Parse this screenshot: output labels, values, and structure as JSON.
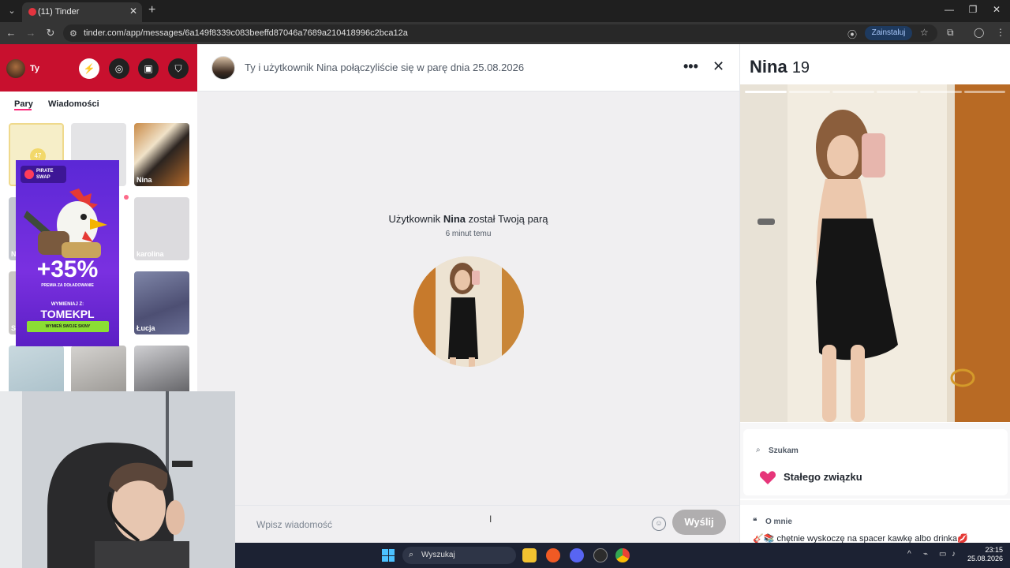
{
  "browser": {
    "tab_title": "(11) Tinder",
    "tab_close": "✕",
    "new_tab": "+",
    "url": "tinder.com/app/messages/6a149f8339c083beeffd87046a7689a210418996c2bca12a",
    "install_label": "Zainstaluj",
    "window_controls": [
      "—",
      "❐",
      "✕"
    ]
  },
  "sidebar": {
    "user_name": "Ty",
    "header_icons": [
      "boost-icon",
      "explore-icon",
      "briefcase-icon",
      "shield-icon"
    ],
    "tabs": [
      "Pary",
      "Wiadomości"
    ],
    "likes_count": "47",
    "matches": [
      {
        "name": ""
      },
      {
        "name": ""
      },
      {
        "name": "Nina"
      },
      {
        "name": "N"
      },
      {
        "name": ""
      },
      {
        "name": "karolina"
      },
      {
        "name": "S"
      },
      {
        "name": ""
      },
      {
        "name": "Łucja"
      },
      {
        "name": ""
      },
      {
        "name": ""
      },
      {
        "name": ""
      }
    ]
  },
  "ad": {
    "brand": "PIRATE SWAP",
    "percent": "+35%",
    "subtitle": "PREMIA ZA DOŁADOWANIE",
    "exchange": "WYMIENIAJ Z:",
    "code": "TOMEKPL",
    "cta": "WYMIEŃ SWOJE SKINY"
  },
  "chat": {
    "header_text": "Ty i użytkownik Nina połączyliście się w parę dnia 25.08.2026",
    "more_icon": "•••",
    "close_icon": "✕",
    "match_prefix": "Użytkownik",
    "match_name": "Nina",
    "match_suffix": "został Twoją parą",
    "match_time": "6 minut temu",
    "composer_placeholder": "Wpisz wiadomość",
    "send_label": "Wyślij"
  },
  "profile": {
    "name": "Nina",
    "age": "19",
    "looking_label": "Szukam",
    "looking_value": "Stałego związku",
    "about_label": "O mnie",
    "about_text": "🎸📚 chętnie wyskoczę na spacer kawkę albo drinka💋",
    "photo_count": 6,
    "active_photo": 1
  },
  "taskbar": {
    "search_label": "Wyszukaj",
    "time": "23:15",
    "date": "25.08.2026"
  },
  "colors": {
    "tinder_red": "#c8102e",
    "accent_pink": "#fd267a",
    "send_disabled": "#b0aeaf",
    "ad_purple": "#6a2ad8",
    "ad_green": "#8bde33"
  }
}
